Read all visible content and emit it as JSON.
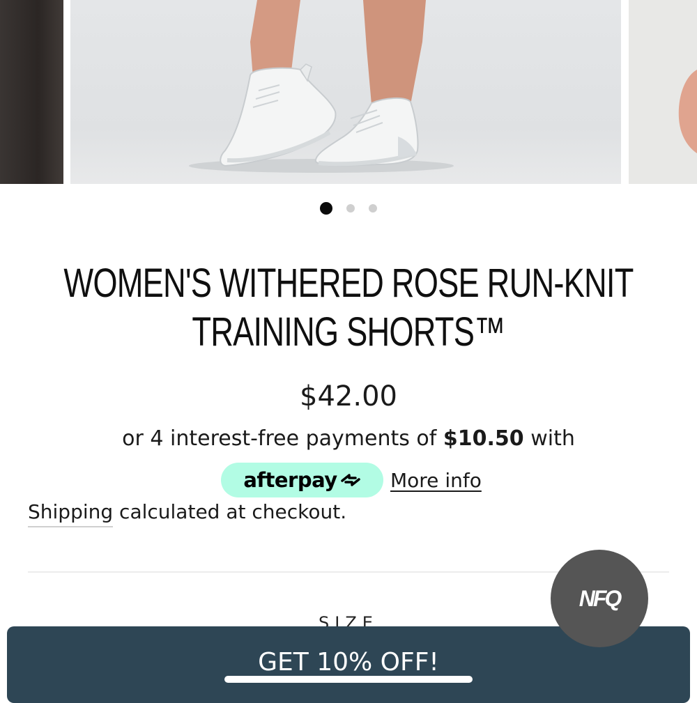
{
  "gallery": {
    "image_count": 3,
    "active_index": 0,
    "main_image_alt": "white running sneakers"
  },
  "product": {
    "title_line1": "WOMEN'S WITHERED ROSE RUN-KNIT",
    "title_line2": "TRAINING SHORTS™",
    "price": "$42.00"
  },
  "afterpay": {
    "text_before": "or 4 interest-free payments of ",
    "amount": "$10.50",
    "text_after": " with",
    "brand": "afterpay",
    "more_info": "More info",
    "badge_color": "#b2fce4"
  },
  "shipping": {
    "link_text": "Shipping",
    "rest_text": " calculated at checkout."
  },
  "options": {
    "size_label": "SIZE"
  },
  "widget": {
    "label": "NFQ"
  },
  "banner": {
    "text": "GET 10% OFF!",
    "color": "#2e4655"
  }
}
